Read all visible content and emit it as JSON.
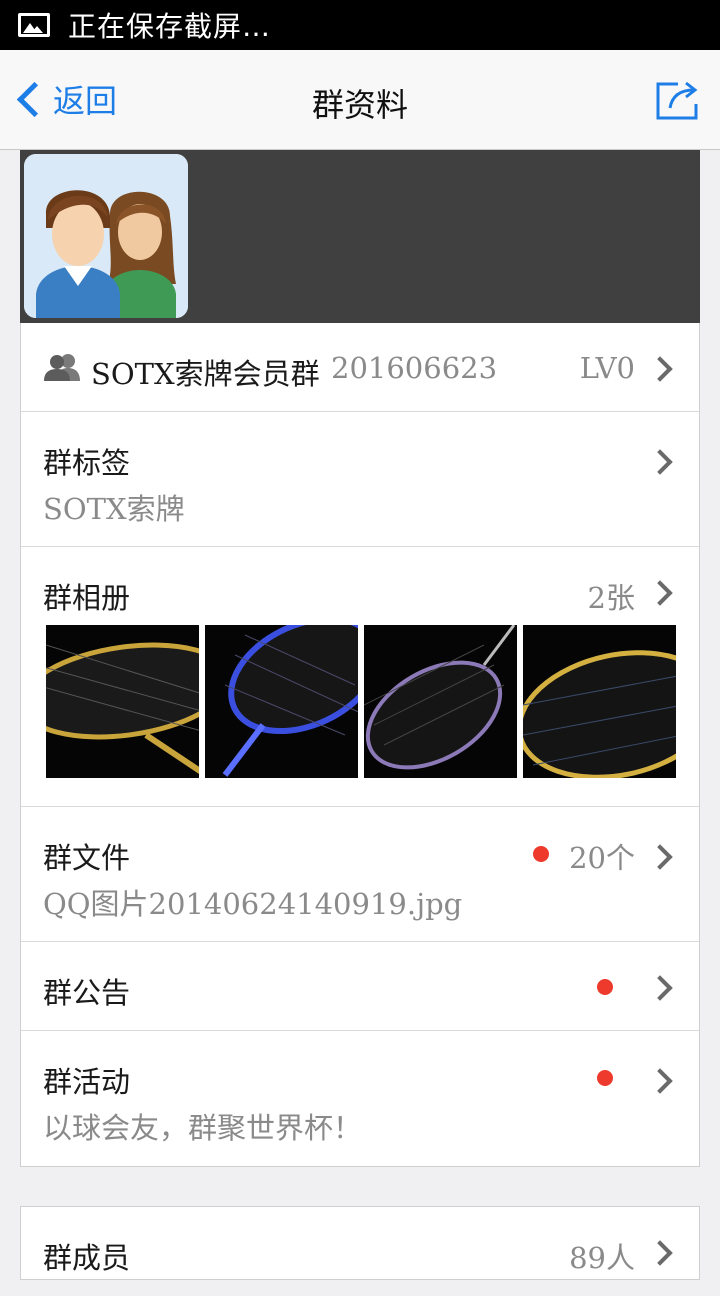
{
  "status_bar": {
    "text": "正在保存截屏…",
    "icon": "image-icon"
  },
  "nav": {
    "back_label": "返回",
    "title": "群资料",
    "share_icon": "share-icon"
  },
  "group": {
    "name": "SOTX索牌会员群",
    "id": "201606623",
    "level": "LV0"
  },
  "tags": {
    "label": "群标签",
    "value": "SOTX索牌"
  },
  "album": {
    "label": "群相册",
    "count": "2张",
    "photos": [
      {
        "name": "racket-photo-gold",
        "accent": "#c9a43a"
      },
      {
        "name": "racket-photo-blue",
        "accent": "#3a4fe0"
      },
      {
        "name": "racket-photo-purple",
        "accent": "#8c7ab8"
      },
      {
        "name": "racket-photo-gold-2",
        "accent": "#d4b040"
      }
    ]
  },
  "files": {
    "label": "群文件",
    "count": "20个",
    "latest": "QQ图片20140624140919.jpg",
    "has_new": true
  },
  "notice": {
    "label": "群公告",
    "has_new": true
  },
  "activity": {
    "label": "群活动",
    "subtitle": "以球会友，群聚世界杯！",
    "has_new": true
  },
  "members": {
    "label": "群成员",
    "count": "89人"
  },
  "colors": {
    "accent": "#1e7ee8",
    "badge": "#ee3a2c",
    "banner": "#404040"
  }
}
